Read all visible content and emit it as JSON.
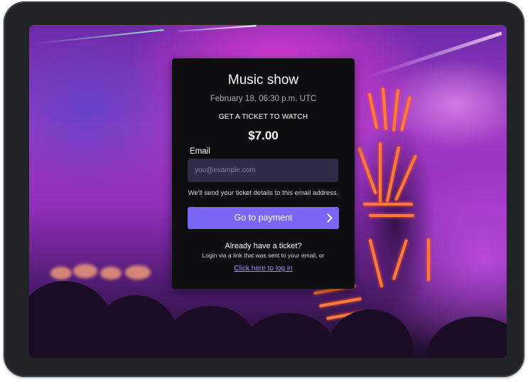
{
  "event": {
    "title": "Music show",
    "date": "February 18, 06:30 p.m. UTC",
    "cta": "GET A TICKET TO WATCH",
    "price": "$7.00"
  },
  "form": {
    "email_label": "Email",
    "email_placeholder": "you@example.com",
    "email_value": "",
    "hint": "We'll send your ticket details to this email address.",
    "submit_label": "Go to payment"
  },
  "login": {
    "heading": "Already have a ticket?",
    "note": "Login via a link that was sent to your email, or",
    "link_label": "Click here to log in"
  },
  "colors": {
    "card_bg": "#0e0e10",
    "input_bg": "#2e2c47",
    "accent": "#7a66f4",
    "link": "#9a8bff"
  },
  "icons": {
    "submit_arrow": "chevron-right-icon"
  }
}
